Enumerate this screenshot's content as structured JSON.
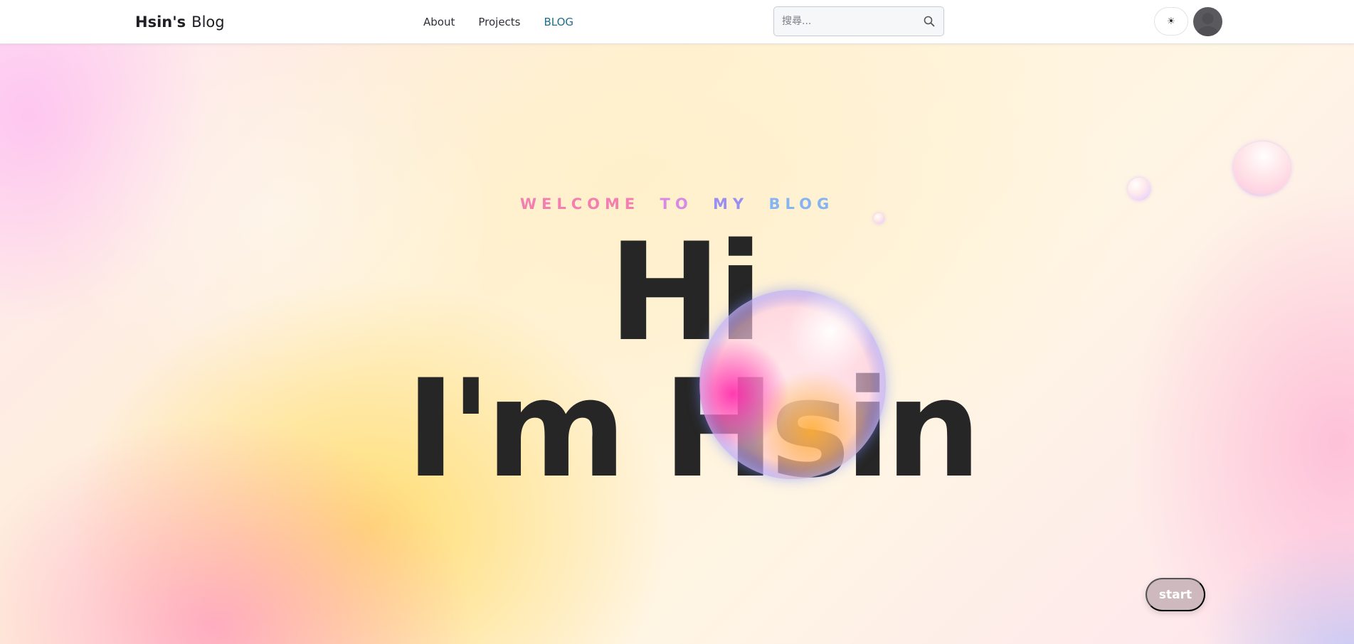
{
  "header": {
    "brand_part1": "Hsin's",
    "brand_part2": "Blog",
    "nav": [
      {
        "label": "About",
        "active": false
      },
      {
        "label": "Projects",
        "active": false
      },
      {
        "label": "BLOG",
        "active": true
      }
    ],
    "search": {
      "placeholder": "搜尋...",
      "icon": "search-icon"
    },
    "theme_toggle": {
      "symbol": "☀",
      "icon": "sun-icon"
    },
    "avatar": {
      "icon": "user-avatar-icon"
    }
  },
  "hero": {
    "welcome_words": [
      "WELCOME",
      "TO",
      "MY",
      "BLOG"
    ],
    "welcome_colors": [
      "#f27fb0",
      "#d889e6",
      "#9a8ef0",
      "#86b4f2"
    ],
    "line1": "Hi",
    "line2": "I'm Hsin",
    "start_label": "start"
  },
  "colors": {
    "accent_link": "#1f6f8b",
    "headline_text": "#262626"
  }
}
